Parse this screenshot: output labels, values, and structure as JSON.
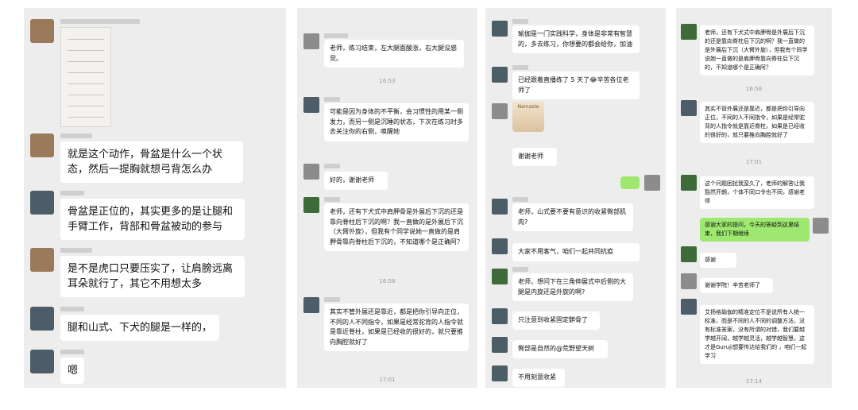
{
  "panel1": {
    "messages": [
      {
        "text": "就是这个动作，骨盆是什么一个状态，然后一提胸就想弓背怎么办"
      },
      {
        "text": "骨盆是正位的，其实更多的是让腿和手臂工作，背部和骨盆被动的参与"
      },
      {
        "text": "是不是虎口只要压实了，让肩膀远离耳朵就行了，其它不用想太多"
      },
      {
        "text": "腿和山式、下犬的腿是一样的，"
      },
      {
        "text": "嗯"
      }
    ]
  },
  "panel2": {
    "messages": [
      {
        "text": "老师，练习结束，左大腿面酸涨，右大腿没感觉。"
      },
      {
        "text": "可能是因为身体的不平衡，会习惯性的用某一侧发力，而另一侧是沉睡的状态，下次在练习时多去关注你的右侧，唤醒她"
      },
      {
        "text": "好的，谢谢老师"
      },
      {
        "text": "老师，还有下犬式中肩胛骨是外展后下沉的还是靠向脊柱后下沉的啊？我一直做的是外展后下沉（大臂外旋），但我有个同学说她一直做的是肩胛骨靠向脊柱后下沉的，不知道哪个是正确阿？"
      },
      {
        "text": "其实不管外展还是靠近，都是把你引导向正位，不同的人不同指令，如果是经常驼背的人指令就是靠近脊柱，如果是已经收的很好的，就只要推向胸腔就好了"
      }
    ],
    "times": [
      "16:53",
      "16:58",
      "17:01"
    ]
  },
  "panel3": {
    "messages": [
      {
        "text": "瑜伽是一门实践科学，身体是非常有智慧的，多去练习，你想要的都会给你，加油"
      },
      {
        "text": "已经跟着直播练了 5 天了😂辛苦各位老师了"
      },
      {
        "text": "谢谢老师"
      },
      {
        "text": "老师，山式要不要有意识的收紧臀部肌肉?"
      },
      {
        "text": "大家不用客气，咱们一起共同抗疫"
      },
      {
        "text": "老师，想问下在三角伸展式中后侧的大腿是内旋还是外旋的啊?"
      },
      {
        "text": "只注意到收紧固定髌骨了"
      },
      {
        "text": "臀部是自然的@荒野望天树"
      },
      {
        "text": "不用刻意收紧"
      }
    ],
    "sticker_text": "Namaste"
  },
  "panel4": {
    "messages": [
      {
        "text": "老师，还有下犬式中肩胛骨是外展后下沉的还是靠向脊柱后下沉的啊？我一直做的是外展后下沉（大臂外旋），但我有个同学说她一直做的是肩胛骨靠向脊柱后下沉的，不知道哪个是正确阿？"
      },
      {
        "text": "其实不管外展还是靠近，都是把你引导向正位，不同的人不同指令，如果是经常驼背的人指令就是靠近脊柱，如果是已经收的很好的，就只要推向胸腔就好了"
      },
      {
        "text": "这个问题困扰我蛮久了，老师的解答让我豁然开朗，个体不同口令也不同，感谢老师"
      },
      {
        "text": "感谢大家的提问，今天的答疑到这里结束，我们下期继续"
      },
      {
        "text": "感谢"
      },
      {
        "text": "谢谢学院！辛苦老师了"
      },
      {
        "text": "艾扬格瑜伽的精准定位不是说所有人统一标准，而是不同的人不同的调整方法，没有标准答案，没有所谓的对错，我们要越学越开阔，越学越灵活，越学越智慧，这才是Guruji想要传达给我们的 ，咱们一起学习"
      }
    ],
    "times": [
      "16:58",
      "17:01",
      "17:14"
    ]
  }
}
